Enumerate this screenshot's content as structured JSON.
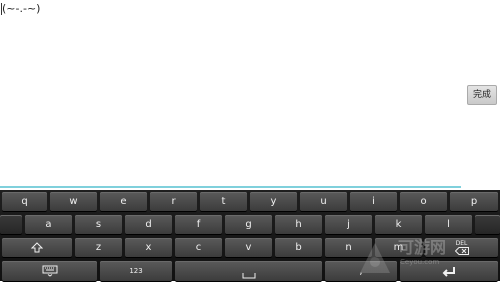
{
  "editor": {
    "text": "(~-.-~)"
  },
  "done_button": {
    "label": "完成"
  },
  "keyboard": {
    "row1": [
      "q",
      "w",
      "e",
      "r",
      "t",
      "y",
      "u",
      "i",
      "o",
      "p"
    ],
    "row2": [
      "a",
      "s",
      "d",
      "f",
      "g",
      "h",
      "j",
      "k",
      "l"
    ],
    "row3": [
      "z",
      "x",
      "c",
      "v",
      "b",
      "n",
      "m"
    ],
    "del_label": "DEL",
    "num_label": "123",
    "symbol_key_partial": ",",
    "icons": {
      "shift": "shift-arrow-up",
      "keyboard_hide": "keyboard-chevron-down",
      "space": "space-bar",
      "enter": "return-arrow",
      "delete": "backspace"
    }
  },
  "watermark": {
    "text": "可游网",
    "url_text": "Ceyou.com"
  },
  "colors": {
    "underline": "#7fd0dc",
    "key_face": "#4a4a4a",
    "keyboard_bg": "#151515"
  }
}
